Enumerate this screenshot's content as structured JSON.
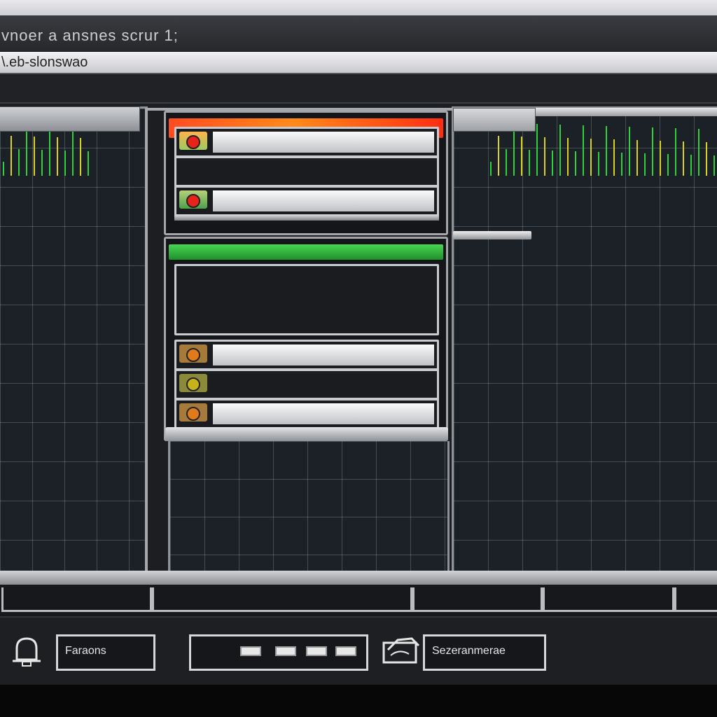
{
  "window": {
    "title": "vnoer a ansnes scrur 1;",
    "path": "\\.eb-slonswao"
  },
  "colors": {
    "scope_green": "#2fd13d",
    "scope_yellow": "#d9d21f",
    "alert_red": "#ff4b1f",
    "ok_green": "#38c544"
  },
  "rack": {
    "top_unit_header": "red",
    "bottom_unit_header": "green",
    "top_slots": [
      {
        "status": "active",
        "led_color": "#e8231a"
      },
      {
        "status": "empty"
      },
      {
        "status": "active",
        "led_color": "#e8231a"
      }
    ],
    "bottom_slots": [
      {
        "status": "empty"
      },
      {
        "status": "active",
        "led_color": "#e07b1c"
      },
      {
        "status": "empty",
        "led_color": "#c8b21c"
      },
      {
        "status": "active",
        "led_color": "#e07b1c"
      }
    ]
  },
  "status_bar": {
    "field_1": "Faraons",
    "field_3": "Sezeranmerae",
    "icons": [
      "bell-icon",
      "folder-icon"
    ]
  }
}
